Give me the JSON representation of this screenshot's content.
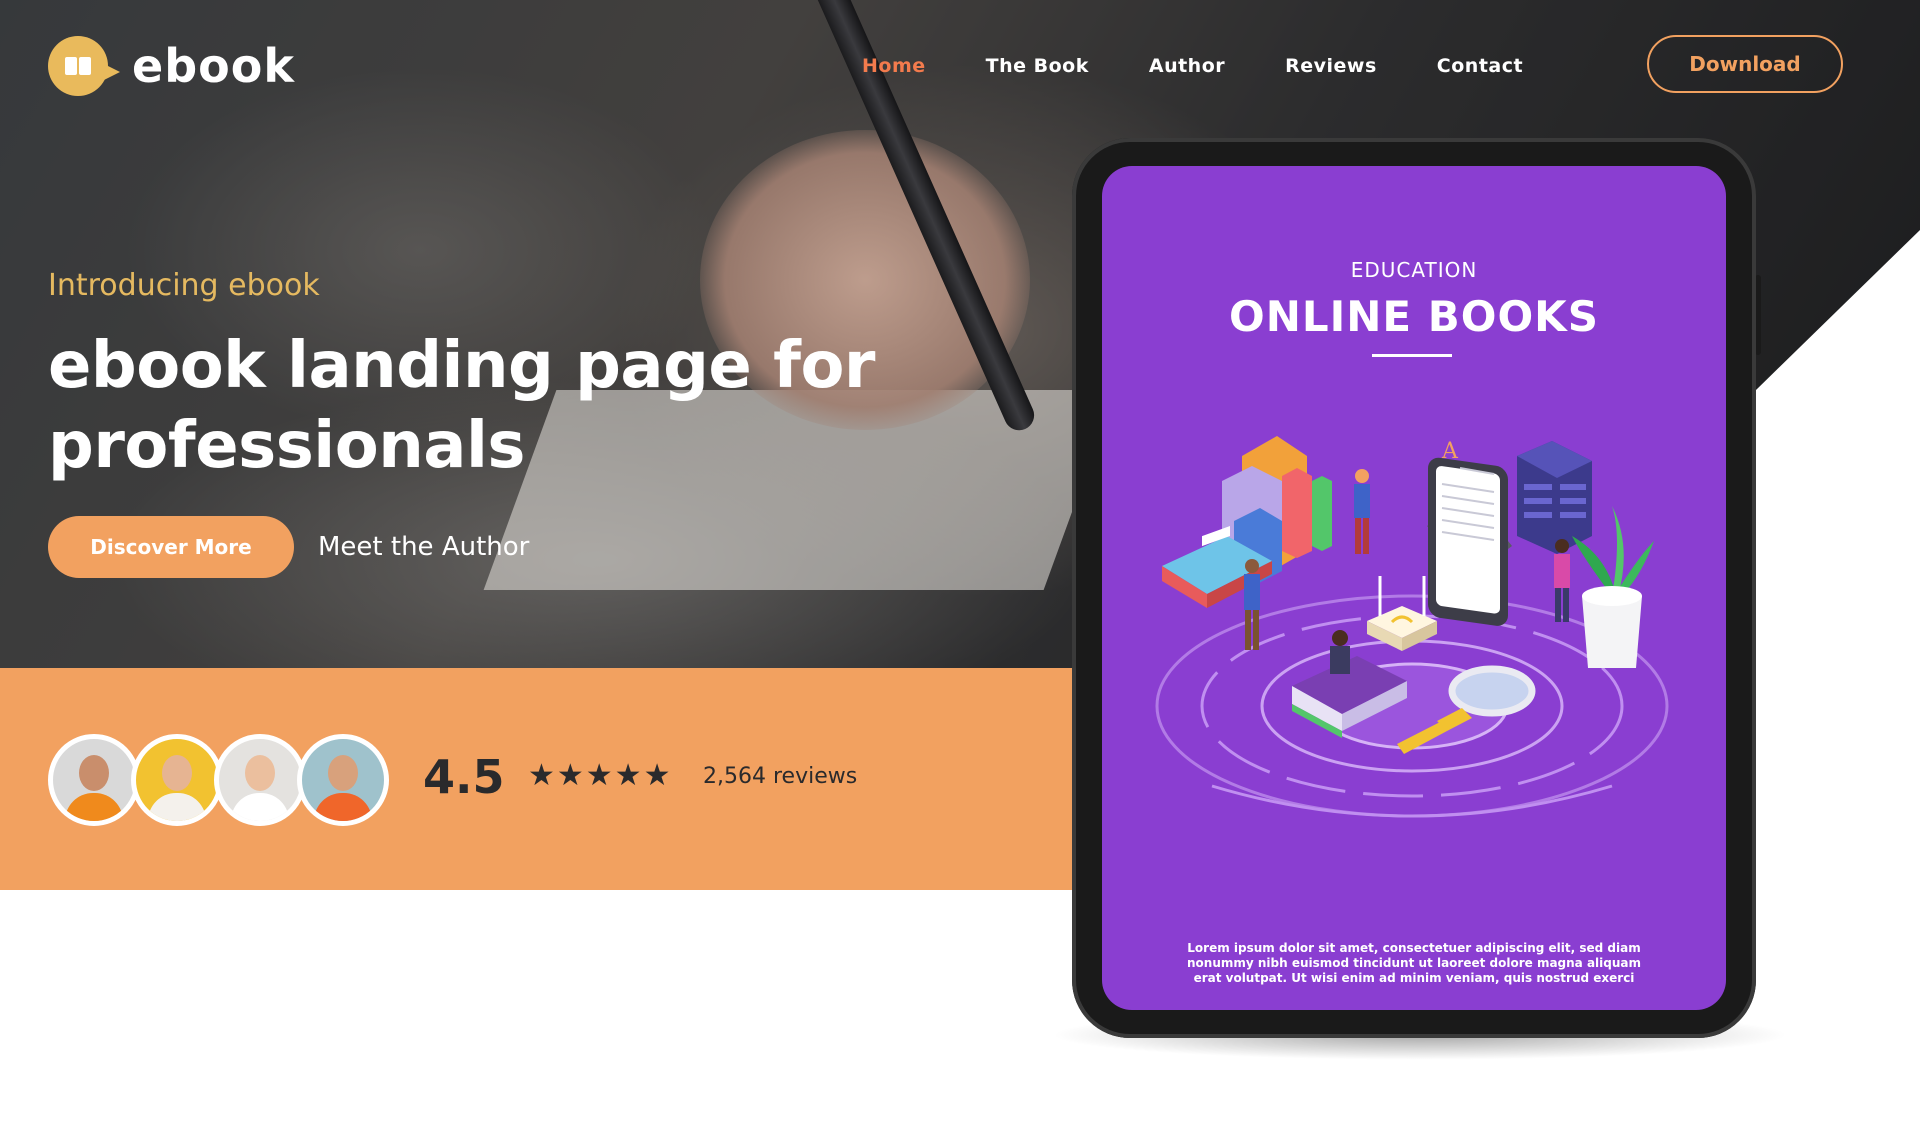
{
  "brand": {
    "name": "ebook"
  },
  "nav": {
    "items": [
      {
        "label": "Home",
        "active": true
      },
      {
        "label": "The Book"
      },
      {
        "label": "Author"
      },
      {
        "label": "Reviews"
      },
      {
        "label": "Contact"
      }
    ],
    "download_label": "Download"
  },
  "hero": {
    "eyebrow": "Introducing ebook",
    "headline": "ebook landing page for professionals",
    "primary_cta": "Discover More",
    "secondary_cta": "Meet the Author"
  },
  "reviews": {
    "rating": "4.5",
    "stars": "★★★★★",
    "count_label": "2,564 reviews"
  },
  "book_cover": {
    "category": "EDUCATION",
    "title": "ONLINE BOOKS",
    "blurb": "Lorem ipsum dolor sit amet, consectetuer adipiscing elit, sed diam nonummy nibh euismod tincidunt ut laoreet dolore magna aliquam erat volutpat. Ut wisi enim ad minim veniam, quis nostrud exerci",
    "illustration_letter": "A"
  },
  "colors": {
    "accent_orange": "#f2a160",
    "nav_active": "#f37b4d",
    "logo_gold": "#e9ba5c",
    "cover_purple": "#8a3ed1"
  }
}
